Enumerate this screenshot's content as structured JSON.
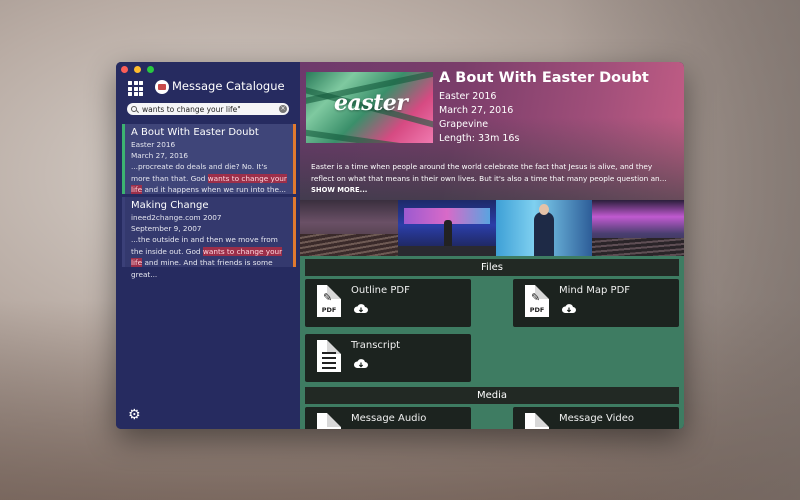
{
  "app": {
    "title": "Message Catalogue"
  },
  "search": {
    "query": "wants to change your life\""
  },
  "results": [
    {
      "title": "A Bout With Easter Doubt",
      "series": "Easter 2016",
      "date": "March 27, 2016",
      "excerpt_before": "...procreate do deals and die? No. It's more than that. God ",
      "excerpt_highlight": "wants to change your life",
      "excerpt_after": " and it happens when we run into the..."
    },
    {
      "title": "Making Change",
      "series": "ineed2change.com 2007",
      "date": "September 9, 2007",
      "excerpt_before": "...the outside in and then we move from the inside out. God ",
      "excerpt_highlight": "wants to change your life",
      "excerpt_after": " and mine. And that friends is some great..."
    }
  ],
  "detail": {
    "art_word": "easter",
    "title": "A Bout With Easter Doubt",
    "series": "Easter 2016",
    "date": "March 27, 2016",
    "location": "Grapevine",
    "length": "Length: 33m 16s",
    "description": "Easter is a time when people around the world celebrate the fact that Jesus is alive, and they reflect on what that means in their own lives. But it's also a time that many people question an...",
    "show_more": "SHOW MORE..."
  },
  "files": {
    "header": "Files",
    "items": [
      {
        "label": "Outline PDF",
        "icon": "pdf-icon",
        "doc_text": "PDF"
      },
      {
        "label": "Mind Map PDF",
        "icon": "pdf-icon",
        "doc_text": "PDF"
      },
      {
        "label": "Transcript",
        "icon": "document-icon"
      }
    ]
  },
  "media": {
    "header": "Media",
    "items": [
      {
        "label": "Message Audio",
        "icon": "audio-icon"
      },
      {
        "label": "Message Video",
        "icon": "video-icon"
      }
    ]
  },
  "colors": {
    "sidebar": "#262b60",
    "selected_result": "#3f4579",
    "accent_green": "#3cb371",
    "accent_orange": "#e07a2f",
    "highlight": "#9c2f4a",
    "main_bg": "#3e7c62"
  }
}
